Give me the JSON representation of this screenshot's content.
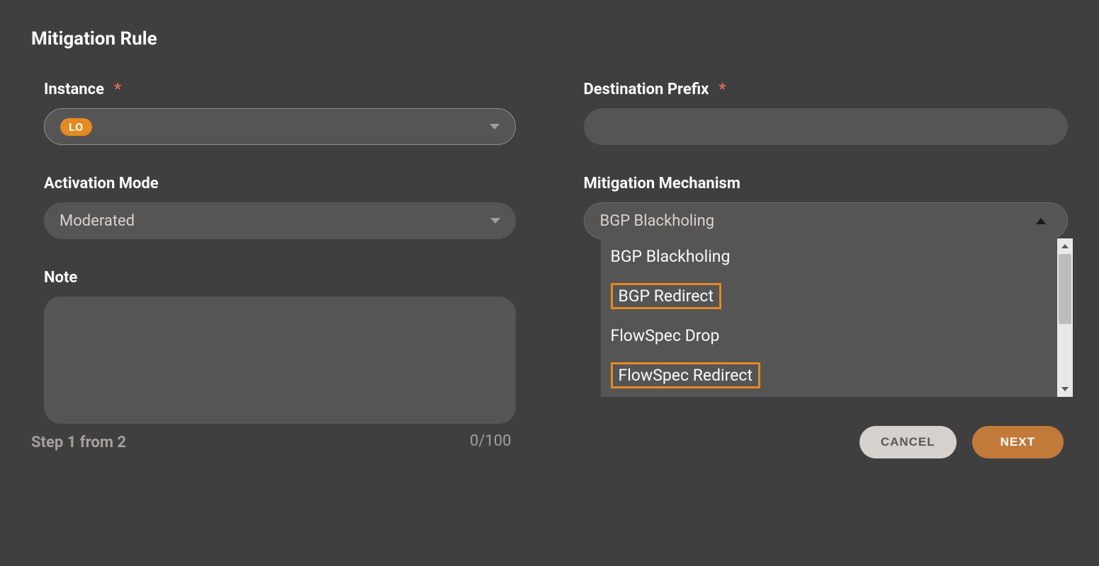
{
  "title": "Mitigation Rule",
  "instance": {
    "label": "Instance",
    "required": "*",
    "chip": "LO"
  },
  "destination": {
    "label": "Destination Prefix",
    "required": "*",
    "value": ""
  },
  "activation": {
    "label": "Activation Mode",
    "value": "Moderated"
  },
  "mechanism": {
    "label": "Mitigation Mechanism",
    "value": "BGP Blackholing",
    "options": [
      {
        "text": "BGP Blackholing",
        "highlighted": false
      },
      {
        "text": "BGP Redirect",
        "highlighted": true
      },
      {
        "text": "FlowSpec Drop",
        "highlighted": false
      },
      {
        "text": "FlowSpec Redirect",
        "highlighted": true
      }
    ]
  },
  "note": {
    "label": "Note",
    "counter": "0/100"
  },
  "footer": {
    "step": "Step 1 from 2",
    "cancel": "CANCEL",
    "next": "NEXT"
  }
}
